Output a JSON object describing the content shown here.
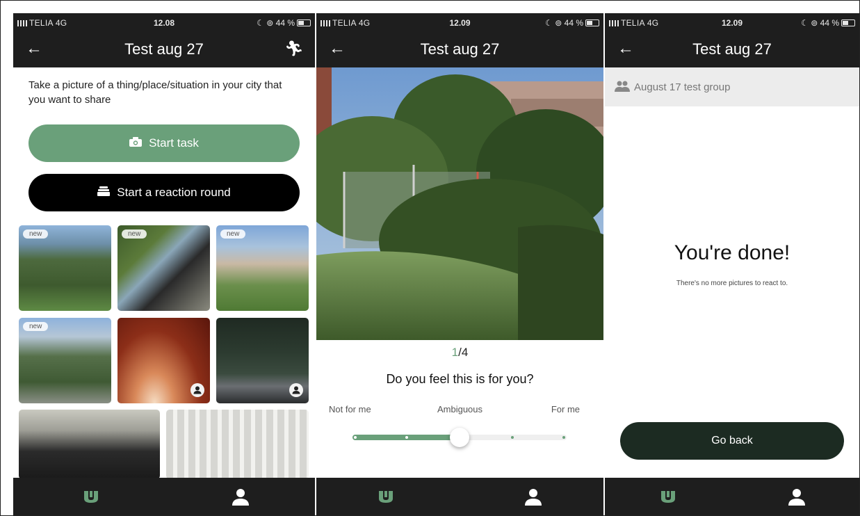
{
  "colors": {
    "accent": "#6aa07a",
    "dark": "#1e1e1e",
    "go_back_bg": "#1c2b22"
  },
  "screens": [
    {
      "status": {
        "carrier": "TELIA  4G",
        "time": "12.08",
        "battery": "44 %"
      },
      "nav": {
        "title": "Test aug 27",
        "back_icon": "arrow-left-icon",
        "right_icon": "running-person-icon"
      },
      "task_text": "Take a picture of a thing/place/situation in your city that you want to share",
      "start_task_label": "Start task",
      "start_task_icon": "camera-icon",
      "reaction_round_label": "Start a reaction round",
      "reaction_round_icon": "stack-icon",
      "thumbnails": [
        {
          "badge": "new"
        },
        {
          "badge": "new"
        },
        {
          "badge": "new"
        },
        {
          "badge": "new"
        },
        {
          "badge": ""
        },
        {
          "badge": ""
        },
        {
          "badge": ""
        },
        {
          "badge": ""
        }
      ],
      "tabs": [
        "home-logo-icon",
        "profile-icon"
      ]
    },
    {
      "status": {
        "carrier": "TELIA  4G",
        "time": "12.09",
        "battery": "44 %"
      },
      "nav": {
        "title": "Test aug 27",
        "back_icon": "arrow-left-icon"
      },
      "counter": {
        "current": "1",
        "total": "/4"
      },
      "question": "Do you feel this is for you?",
      "scale": {
        "left": "Not for me",
        "middle": "Ambiguous",
        "right": "For me",
        "value": 0.5
      },
      "tabs": [
        "home-logo-icon",
        "profile-icon"
      ]
    },
    {
      "status": {
        "carrier": "TELIA  4G",
        "time": "12.09",
        "battery": "44 %"
      },
      "nav": {
        "title": "Test aug 27",
        "back_icon": "arrow-left-icon"
      },
      "group_name": "August 17 test group",
      "done_title": "You're done!",
      "done_sub": "There's no more pictures to react to.",
      "go_back_label": "Go back",
      "tabs": [
        "home-logo-icon",
        "profile-icon"
      ]
    }
  ]
}
